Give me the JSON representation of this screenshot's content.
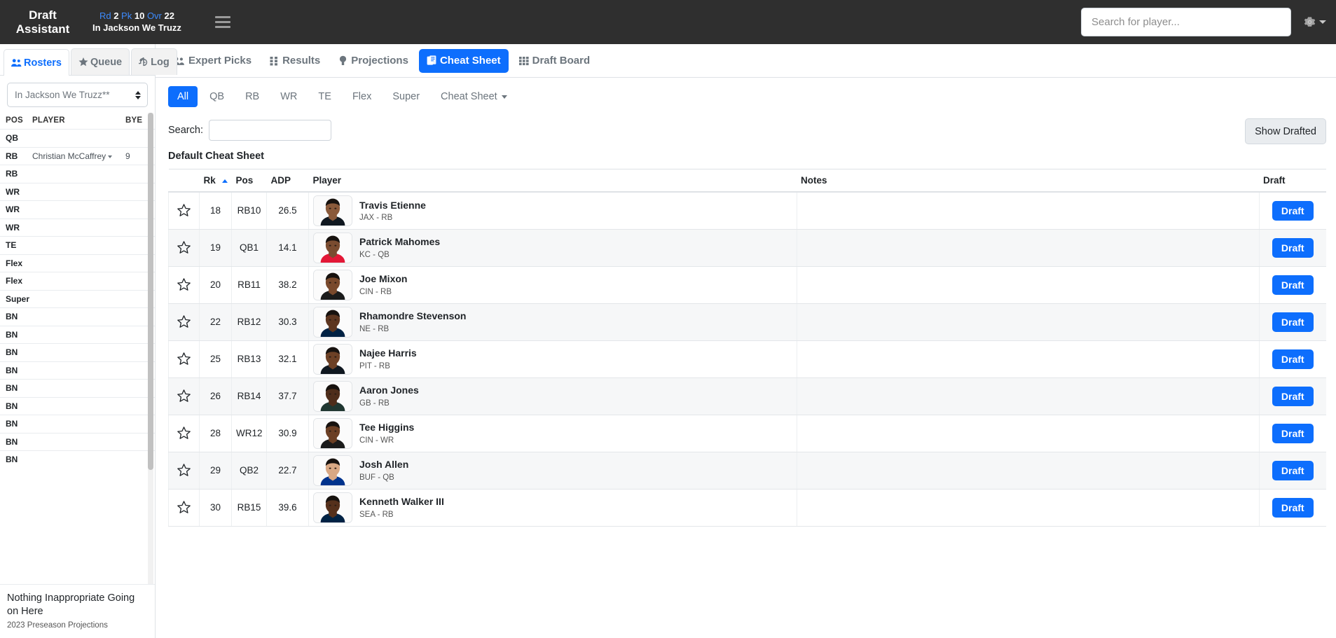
{
  "topbar": {
    "brand_line1": "Draft",
    "brand_line2": "Assistant",
    "rd_label": "Rd",
    "rd_value": "2",
    "pk_label": "Pk",
    "pk_value": "10",
    "ovr_label": "Ovr",
    "ovr_value": "22",
    "team_name": "In Jackson We Truzz",
    "menu_icon": "hamburger-icon",
    "search_placeholder": "Search for player...",
    "search_value": "",
    "settings_icon": "gear-icon",
    "accent_color": "#0d6efd",
    "bar_color": "#2f2f2f"
  },
  "sidebar": {
    "tabs": [
      {
        "label": "Rosters",
        "icon": "people-icon",
        "active": true
      },
      {
        "label": "Queue",
        "icon": "star-icon",
        "active": false
      },
      {
        "label": "Log",
        "icon": "history-icon",
        "active": false
      }
    ],
    "team_select": {
      "value": "In Jackson We Truzz**",
      "icon": "select-arrows-icon"
    },
    "roster_headers": [
      "POS",
      "PLAYER",
      "BYE"
    ],
    "roster_rows": [
      {
        "pos": "QB",
        "player": "",
        "bye": ""
      },
      {
        "pos": "RB",
        "player": "Christian McCaffrey",
        "bye": "9"
      },
      {
        "pos": "RB",
        "player": "",
        "bye": ""
      },
      {
        "pos": "WR",
        "player": "",
        "bye": ""
      },
      {
        "pos": "WR",
        "player": "",
        "bye": ""
      },
      {
        "pos": "WR",
        "player": "",
        "bye": ""
      },
      {
        "pos": "TE",
        "player": "",
        "bye": ""
      },
      {
        "pos": "Flex",
        "player": "",
        "bye": ""
      },
      {
        "pos": "Flex",
        "player": "",
        "bye": ""
      },
      {
        "pos": "Super",
        "player": "",
        "bye": ""
      },
      {
        "pos": "BN",
        "player": "",
        "bye": ""
      },
      {
        "pos": "BN",
        "player": "",
        "bye": ""
      },
      {
        "pos": "BN",
        "player": "",
        "bye": ""
      },
      {
        "pos": "BN",
        "player": "",
        "bye": ""
      },
      {
        "pos": "BN",
        "player": "",
        "bye": ""
      },
      {
        "pos": "BN",
        "player": "",
        "bye": ""
      },
      {
        "pos": "BN",
        "player": "",
        "bye": ""
      },
      {
        "pos": "BN",
        "player": "",
        "bye": ""
      },
      {
        "pos": "BN",
        "player": "",
        "bye": ""
      }
    ],
    "footer": {
      "title": "Nothing Inappropriate Going on Here",
      "subtitle": "2023 Preseason Projections"
    }
  },
  "main": {
    "tabs": [
      {
        "label": "Expert Picks",
        "icon": "people-icon",
        "active": false
      },
      {
        "label": "Results",
        "icon": "grid-dots-icon",
        "active": false
      },
      {
        "label": "Projections",
        "icon": "lightbulb-icon",
        "active": false
      },
      {
        "label": "Cheat Sheet",
        "icon": "clipboard-icon",
        "active": true
      },
      {
        "label": "Draft Board",
        "icon": "grid-icon",
        "active": false
      }
    ],
    "position_filters": [
      {
        "label": "All",
        "active": true
      },
      {
        "label": "QB",
        "active": false
      },
      {
        "label": "RB",
        "active": false
      },
      {
        "label": "WR",
        "active": false
      },
      {
        "label": "TE",
        "active": false
      },
      {
        "label": "Flex",
        "active": false
      },
      {
        "label": "Super",
        "active": false
      }
    ],
    "cheat_sheet_dropdown": "Cheat Sheet",
    "search_label": "Search:",
    "search_value": "",
    "show_drafted_label": "Show Drafted",
    "sheet_title": "Default Cheat Sheet",
    "table": {
      "headers": {
        "star": "",
        "rk": "Rk",
        "pos": "Pos",
        "adp": "ADP",
        "player": "Player",
        "notes": "Notes",
        "draft": "Draft"
      },
      "sort_column": "Rk",
      "sort_direction": "asc",
      "draft_button_label": "Draft",
      "rows": [
        {
          "rk": "18",
          "pos": "RB10",
          "adp": "26.5",
          "name": "Travis Etienne",
          "meta": "JAX - RB",
          "notes": "",
          "jersey": "#101820",
          "skin": "#8a5a3b"
        },
        {
          "rk": "19",
          "pos": "QB1",
          "adp": "14.1",
          "name": "Patrick Mahomes",
          "meta": "KC - QB",
          "notes": "",
          "jersey": "#e31837",
          "skin": "#7a4c30"
        },
        {
          "rk": "20",
          "pos": "RB11",
          "adp": "38.2",
          "name": "Joe Mixon",
          "meta": "CIN - RB",
          "notes": "",
          "jersey": "#1b1b1b",
          "skin": "#79492c"
        },
        {
          "rk": "22",
          "pos": "RB12",
          "adp": "30.3",
          "name": "Rhamondre Stevenson",
          "meta": "NE - RB",
          "notes": "",
          "jersey": "#002244",
          "skin": "#5d3620"
        },
        {
          "rk": "25",
          "pos": "RB13",
          "adp": "32.1",
          "name": "Najee Harris",
          "meta": "PIT - RB",
          "notes": "",
          "jersey": "#101820",
          "skin": "#6d4126"
        },
        {
          "rk": "26",
          "pos": "RB14",
          "adp": "37.7",
          "name": "Aaron Jones",
          "meta": "GB - RB",
          "notes": "",
          "jersey": "#203731",
          "skin": "#4e2d1a"
        },
        {
          "rk": "28",
          "pos": "WR12",
          "adp": "30.9",
          "name": "Tee Higgins",
          "meta": "CIN - WR",
          "notes": "",
          "jersey": "#1b1b1b",
          "skin": "#6b3f24"
        },
        {
          "rk": "29",
          "pos": "QB2",
          "adp": "22.7",
          "name": "Josh Allen",
          "meta": "BUF - QB",
          "notes": "",
          "jersey": "#00338d",
          "skin": "#d9a884"
        },
        {
          "rk": "30",
          "pos": "RB15",
          "adp": "39.6",
          "name": "Kenneth Walker III",
          "meta": "SEA - RB",
          "notes": "",
          "jersey": "#002244",
          "skin": "#55301b"
        }
      ]
    }
  }
}
